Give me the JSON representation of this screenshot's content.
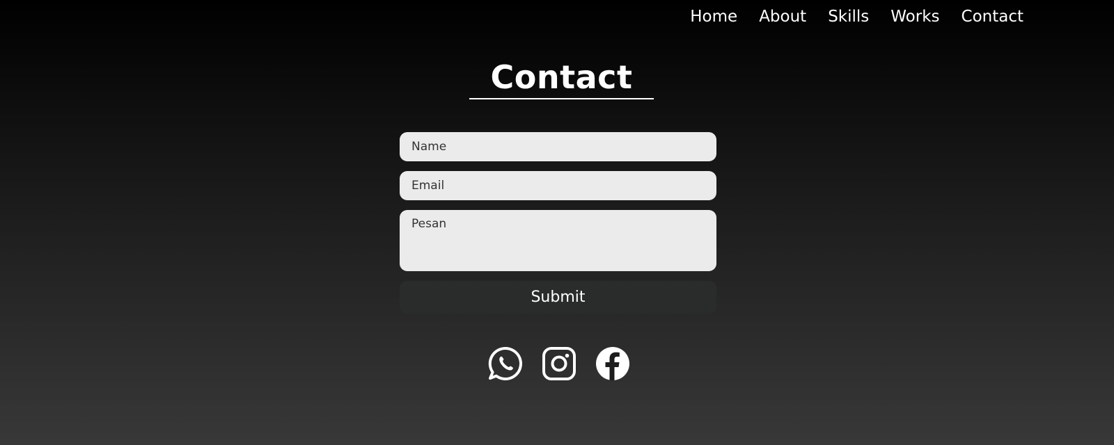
{
  "nav": {
    "items": [
      {
        "label": "Home"
      },
      {
        "label": "About"
      },
      {
        "label": "Skills"
      },
      {
        "label": "Works"
      },
      {
        "label": "Contact"
      }
    ]
  },
  "contact": {
    "title": "Contact",
    "form": {
      "name_placeholder": "Name",
      "email_placeholder": "Email",
      "message_placeholder": "Pesan",
      "submit_label": "Submit"
    },
    "social": [
      {
        "icon": "whatsapp-icon"
      },
      {
        "icon": "instagram-icon"
      },
      {
        "icon": "facebook-icon"
      }
    ]
  },
  "colors": {
    "input_bg": "#ebebeb",
    "button_bg": "#2a2c2c",
    "text": "#ffffff"
  }
}
